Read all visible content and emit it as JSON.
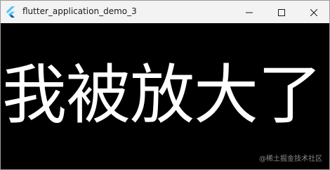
{
  "window": {
    "title": "flutter_application_demo_3",
    "app_icon": "flutter-logo-icon",
    "controls": {
      "minimize_icon": "minimize-icon",
      "maximize_icon": "maximize-icon",
      "close_icon": "close-icon"
    }
  },
  "content": {
    "background": "#000000",
    "text": "我被放大了",
    "text_color": "#ffffff"
  },
  "watermark": {
    "text": "@稀土掘金技术社区"
  }
}
